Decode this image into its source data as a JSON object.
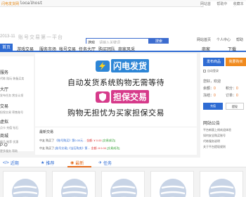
{
  "topbar": {
    "welcome": "闪电发货网",
    "host": "localhost",
    "right_links": [
      "网站首页",
      "帮助中心",
      "收藏本站"
    ]
  },
  "header": {
    "date": "2013-11",
    "slogan": "账号交易第一平台",
    "search_category": "游戏",
    "search_placeholder": "请输入关键词",
    "search_button": "搜索",
    "hot_words": "热门搜索：",
    "links": [
      "网站首页",
      "个人中心",
      "帮助"
    ]
  },
  "nav": {
    "items": [
      "首页",
      "游戏交易",
      "服务市场",
      "帐号交易",
      "任务大厅",
      "购买团队",
      "商家风采"
    ],
    "right1": "商家",
    "right2": "下载"
  },
  "left_categories": [
    {
      "title": "服务",
      "sub": "代练 陪玩 装备买卖"
    },
    {
      "title": "大厅",
      "sub": "发布任务 赏金认领"
    },
    {
      "title": "交易",
      "sub": "担保交易 寄售账号"
    },
    {
      "title": "虚拟",
      "sub": "点卡 充值 钻石"
    },
    {
      "title": "商城",
      "sub": "精品 推荐 优惠"
    },
    {
      "title": "P·O",
      "sub": "更多服务 帮助"
    }
  ],
  "banner": {
    "logo1": "闪电发货",
    "line1": "自动发货系统购物无需等待",
    "logo2": "担保交易",
    "line2": "购物无担忧为买家担保交易",
    "logo1_color": "#2e86d6",
    "logo2_color": "#d63a8a"
  },
  "latest": {
    "title": "最新交易",
    "rows": [
      {
        "who": "中友 购买了",
        "item": "《账号购买》第0.00元…",
        "price": "金额: ¥ 0.00",
        "status": "[交易成功]"
      },
      {
        "who": "中友 购买了",
        "item": "[账号交易]《宝石购卖》第…",
        "price": "金额: ¥ 0.00",
        "status": "[交易成功]"
      }
    ]
  },
  "right_panel": {
    "btn_publish": "发布商品",
    "btn_buy": "我要购买",
    "checkbox_label": "自动登录",
    "hello": "您好，欢迎",
    "balance_label": "余额：",
    "balance_value": "0",
    "points_label": "积分：",
    "points_value": "0",
    "frozen_label": "冻结：",
    "frozen_value": "0",
    "orders_label": "订单：",
    "orders_value": "0",
    "btn_recharge": "充值",
    "btn_withdraw": "提现",
    "notice_title": "网站公告",
    "notices": [
      "平台新版上线欢迎体验",
      "如何安全购买账号",
      "代练服务说明",
      "关于平台提现规则"
    ]
  },
  "tabs": [
    {
      "icon": "</>",
      "label": "近期"
    },
    {
      "icon": "★",
      "label": "推荐"
    },
    {
      "icon": "◉",
      "label": "最新"
    },
    {
      "icon": "✈",
      "label": "任务"
    }
  ],
  "cards": [
    {
      "icon": "globe-icon"
    },
    {
      "icon": "globe-icon"
    },
    {
      "icon": "globe-icon"
    },
    {
      "icon": "globe-icon"
    },
    {
      "icon": "globe-icon"
    }
  ]
}
